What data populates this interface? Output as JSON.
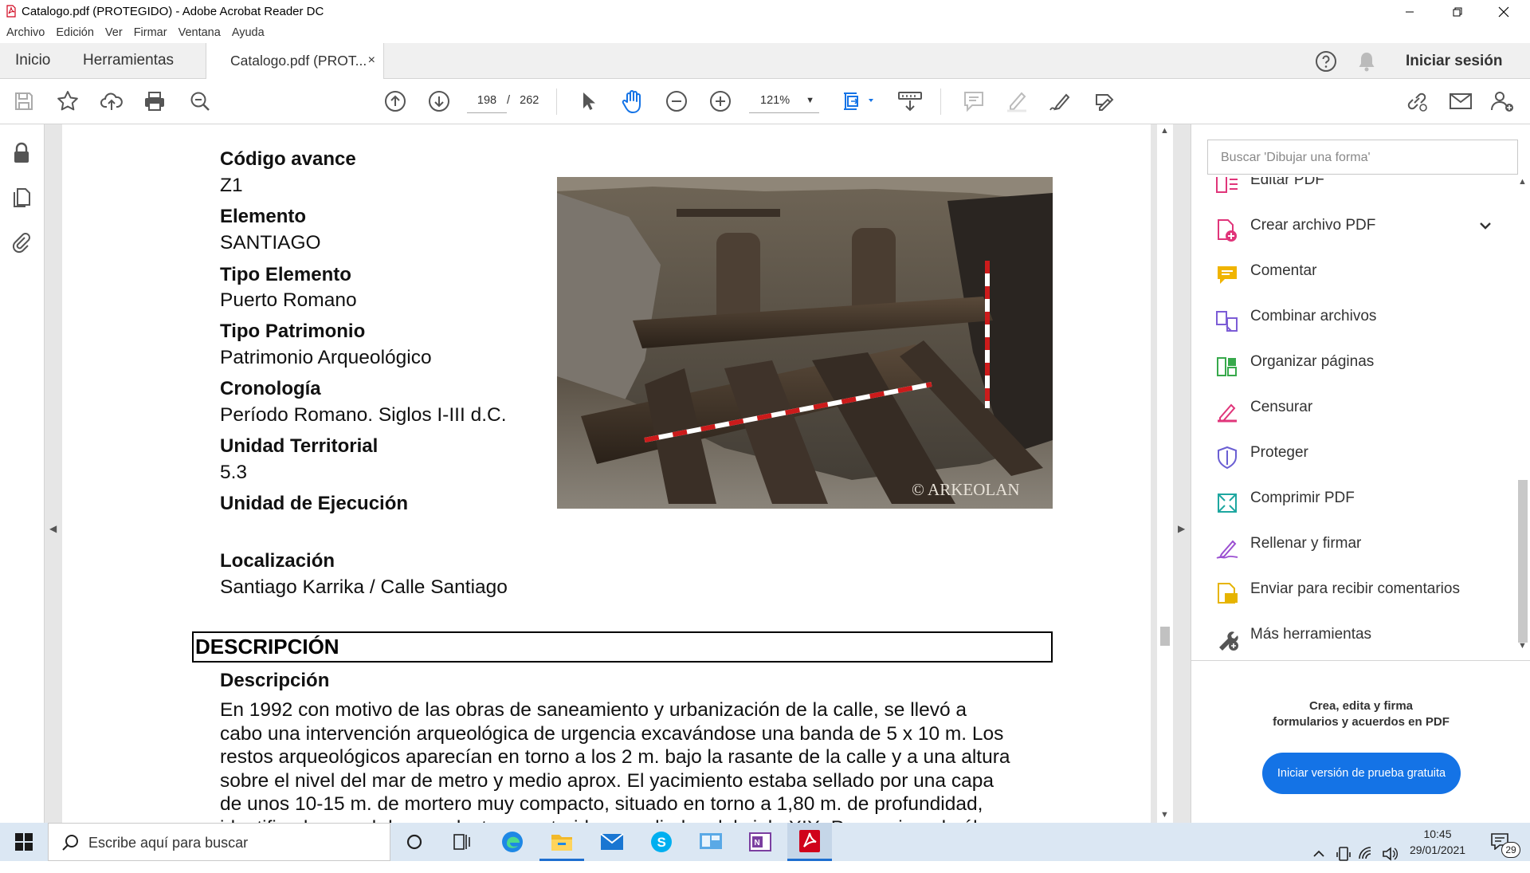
{
  "window": {
    "title": "Catalogo.pdf (PROTEGIDO) - Adobe Acrobat Reader DC"
  },
  "menu": [
    "Archivo",
    "Edición",
    "Ver",
    "Firmar",
    "Ventana",
    "Ayuda"
  ],
  "tabs": {
    "home": "Inicio",
    "tools": "Herramientas",
    "document": "Catalogo.pdf (PROT...",
    "close": "×"
  },
  "header": {
    "sign_in": "Iniciar sesión"
  },
  "toolbar": {
    "page_current": "198",
    "page_separator": "/",
    "page_total": "262",
    "zoom": "121%"
  },
  "document": {
    "fields": [
      {
        "label": "Código avance",
        "value": "Z1"
      },
      {
        "label": "Elemento",
        "value": "SANTIAGO"
      },
      {
        "label": "Tipo Elemento",
        "value": "Puerto Romano"
      },
      {
        "label": "Tipo Patrimonio",
        "value": "Patrimonio Arqueológico"
      },
      {
        "label": "Cronología",
        "value": "Período Romano. Siglos I-III d.C."
      },
      {
        "label": "Unidad Territorial",
        "value": "5.3"
      },
      {
        "label": "Unidad de Ejecución",
        "value": ""
      },
      {
        "label": "Localización",
        "value": "Santiago Karrika / Calle Santiago"
      }
    ],
    "photo_credit": "© ARKEOLAN",
    "section_title": "DESCRIPCIÓN",
    "desc_label": "Descripción",
    "desc_lines": [
      "En 1992 con motivo de las obras de saneamiento y urbanización de la calle, se llevó a",
      "cabo una intervención arqueológica de urgencia excavándose una banda de 5 x 10 m. Los",
      "restos arqueológicos aparecían en torno a los 2 m. bajo la rasante de la calle y a una altura",
      "sobre el nivel del mar de metro y medio aprox. El yacimiento estaba sellado por una capa",
      "de unos 10-15 m. de mortero muy compacto, situado en  torno a 1,80 m. de profundidad,",
      "identificado con el de un colector construido a mediados del siglo XIX. Por encima de él"
    ]
  },
  "right_panel": {
    "search_placeholder": "Buscar 'Dibujar una forma'",
    "tools": [
      {
        "label": "Editar PDF",
        "icon": "edit-pdf-icon",
        "color": "#e0357a"
      },
      {
        "label": "Crear archivo PDF",
        "icon": "create-pdf-icon",
        "color": "#e0357a"
      },
      {
        "label": "Comentar",
        "icon": "comment-icon",
        "color": "#f0b400"
      },
      {
        "label": "Combinar archivos",
        "icon": "combine-files-icon",
        "color": "#7c5cd6"
      },
      {
        "label": "Organizar páginas",
        "icon": "organize-pages-icon",
        "color": "#37a94b"
      },
      {
        "label": "Censurar",
        "icon": "redact-icon",
        "color": "#e0357a"
      },
      {
        "label": "Proteger",
        "icon": "protect-icon",
        "color": "#6b5fd3"
      },
      {
        "label": "Comprimir PDF",
        "icon": "compress-pdf-icon",
        "color": "#1ea7a0"
      },
      {
        "label": "Rellenar y firmar",
        "icon": "fill-sign-icon",
        "color": "#9b4fd1"
      },
      {
        "label": "Enviar para recibir comentarios",
        "icon": "send-comments-icon",
        "color": "#e6b400"
      },
      {
        "label": "Más herramientas",
        "icon": "more-tools-icon",
        "color": "#555555"
      }
    ],
    "promo_line1": "Crea, edita y firma",
    "promo_line2": "formularios y acuerdos en PDF",
    "trial_button": "Iniciar versión de prueba gratuita"
  },
  "taskbar": {
    "search_placeholder": "Escribe aquí para buscar",
    "time": "10:45",
    "date": "29/01/2021",
    "notifications": "29"
  }
}
